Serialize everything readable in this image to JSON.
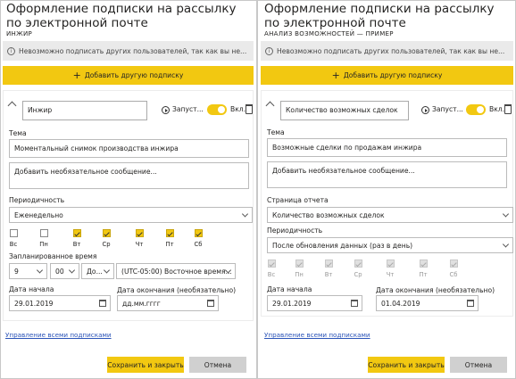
{
  "left": {
    "title": "Оформление подписки на рассылку по электронной почте",
    "subtitle": "ИНЖИР",
    "warning": "Невозможно подписать других пользователей, так как вы не...",
    "add_subscription": "Добавить другую подписку",
    "name_value": "Инжир",
    "run_label": "Запуст...",
    "toggle_label": "Вкл.",
    "subject_label": "Тема",
    "subject_value": "Моментальный снимок производства инжира",
    "message_placeholder": "Добавить необязательное сообщение...",
    "frequency_label": "Периодичность",
    "frequency_value": "Еженедельно",
    "days": [
      {
        "label": "Вс",
        "checked": false
      },
      {
        "label": "Пн",
        "checked": false
      },
      {
        "label": "Вт",
        "checked": true
      },
      {
        "label": "Ср",
        "checked": true
      },
      {
        "label": "Чт",
        "checked": true
      },
      {
        "label": "Пт",
        "checked": true
      },
      {
        "label": "Сб",
        "checked": true
      }
    ],
    "scheduled_time_label": "Запланированное время",
    "hour": "9",
    "minute": "00",
    "ampm": "До...",
    "timezone": "(UTC-05:00) Восточное время...",
    "start_label": "Дата начала",
    "start_value": "29.01.2019",
    "end_label": "Дата окончания (необязательно)",
    "end_value": "дд.мм.гггг",
    "manage_link": "Управление всеми подписками",
    "save_button": "Сохранить и закрыть",
    "cancel_button": "Отмена"
  },
  "right": {
    "title": "Оформление подписки на рассылку по электронной почте",
    "subtitle": "АНАЛИЗ ВОЗМОЖНОСТЕЙ — ПРИМЕР",
    "warning": "Невозможно подписать других пользователей, так как вы не...",
    "add_subscription": "Добавить другую подписку",
    "name_value": "Количество возможных сделок",
    "run_label": "Запуст...",
    "toggle_label": "Вкл.",
    "subject_label": "Тема",
    "subject_value": "Возможные сделки по продажам инжира",
    "message_placeholder": "Добавить необязательное сообщение...",
    "report_page_label": "Страница отчета",
    "report_page_value": "Количество возможных сделок",
    "frequency_label": "Периодичность",
    "frequency_value": "После обновления данных (раз в день)",
    "days": [
      {
        "label": "Вс",
        "checked": true
      },
      {
        "label": "Пн",
        "checked": true
      },
      {
        "label": "Вт",
        "checked": true
      },
      {
        "label": "Ср",
        "checked": true
      },
      {
        "label": "Чт",
        "checked": true
      },
      {
        "label": "Пт",
        "checked": true
      },
      {
        "label": "Сб",
        "checked": true
      }
    ],
    "start_label": "Дата начала",
    "start_value": "29.01.2019",
    "end_label": "Дата окончания (необязательно)",
    "end_value": "01.04.2019",
    "manage_link": "Управление всеми подписками",
    "save_button": "Сохранить и закрыть",
    "cancel_button": "Отмена"
  },
  "colors": {
    "accent": "#f2c811",
    "link": "#2b54b8",
    "warning_bg": "#eaeaea",
    "secondary_button": "#d0d0d0"
  }
}
